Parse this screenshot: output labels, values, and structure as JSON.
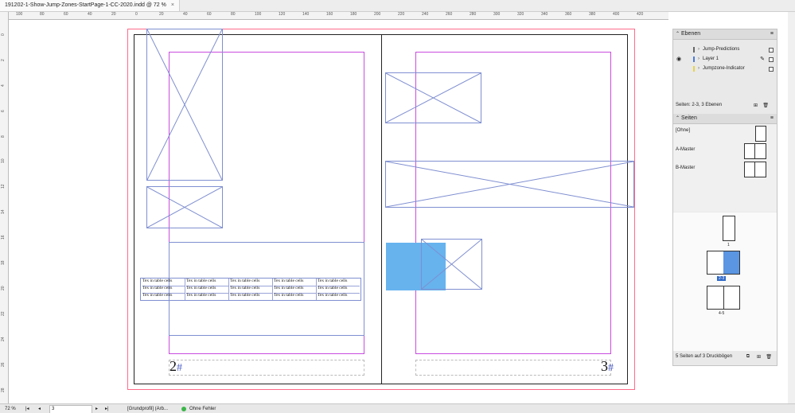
{
  "tab": {
    "title": "191202-1-Show-Jump-Zones-StartPage-1-CC-2020.indd @ 72 %",
    "close": "×"
  },
  "ruler": {
    "h_labels": [
      "100",
      "80",
      "60",
      "40",
      "20",
      "0",
      "20",
      "40",
      "60",
      "80",
      "100",
      "120",
      "140",
      "160",
      "180",
      "200",
      "220",
      "240",
      "260",
      "280",
      "300",
      "320",
      "340",
      "360",
      "380",
      "400",
      "420"
    ],
    "v_labels": [
      "0",
      "2",
      "4",
      "6",
      "8",
      "10",
      "12",
      "14",
      "16",
      "18",
      "20",
      "22",
      "24",
      "26",
      "28"
    ]
  },
  "table": {
    "rows": [
      [
        "Tex in table cells",
        "Tex in table cells",
        "Tex in table cells",
        "Tex in table cells",
        "Tex in table cells"
      ],
      [
        "Tex in table cells",
        "Tex in table cells",
        "Tex in table cells",
        "Tex in table cells",
        "Tex in table cells"
      ],
      [
        "Tex in table cells",
        "Tex in table cells",
        "Tex in table cells",
        "Tex in table cells",
        "Tex in table cells"
      ]
    ]
  },
  "page_numbers": {
    "left": "2",
    "right": "3",
    "marker": "#"
  },
  "layers_panel": {
    "title": "Ebenen",
    "items": [
      {
        "name": "Jump-Predictions",
        "color": "#666666"
      },
      {
        "name": "Layer 1",
        "color": "#4b7bd8"
      },
      {
        "name": "Jumpzone-Indicator",
        "color": "#e8d24a"
      }
    ],
    "footer": "Seiten: 2-3, 3 Ebenen"
  },
  "pages_panel": {
    "title": "Seiten",
    "masters": [
      "[Ohne]",
      "A-Master",
      "B-Master"
    ],
    "spreads": [
      {
        "label": "1"
      },
      {
        "label": "2-3"
      },
      {
        "label": "4-5"
      }
    ],
    "footer": "5 Seiten auf 3 Druckbögen"
  },
  "status": {
    "zoom": "72 %",
    "page": "3",
    "profile": "[Grundprofil] (Arb...",
    "preflight": "Ohne Fehler"
  },
  "colors": {
    "accent": "#4b8fe0",
    "bleed": "#ff6a8a",
    "margin": "#c94ce0",
    "frame": "#7f8fd1"
  }
}
